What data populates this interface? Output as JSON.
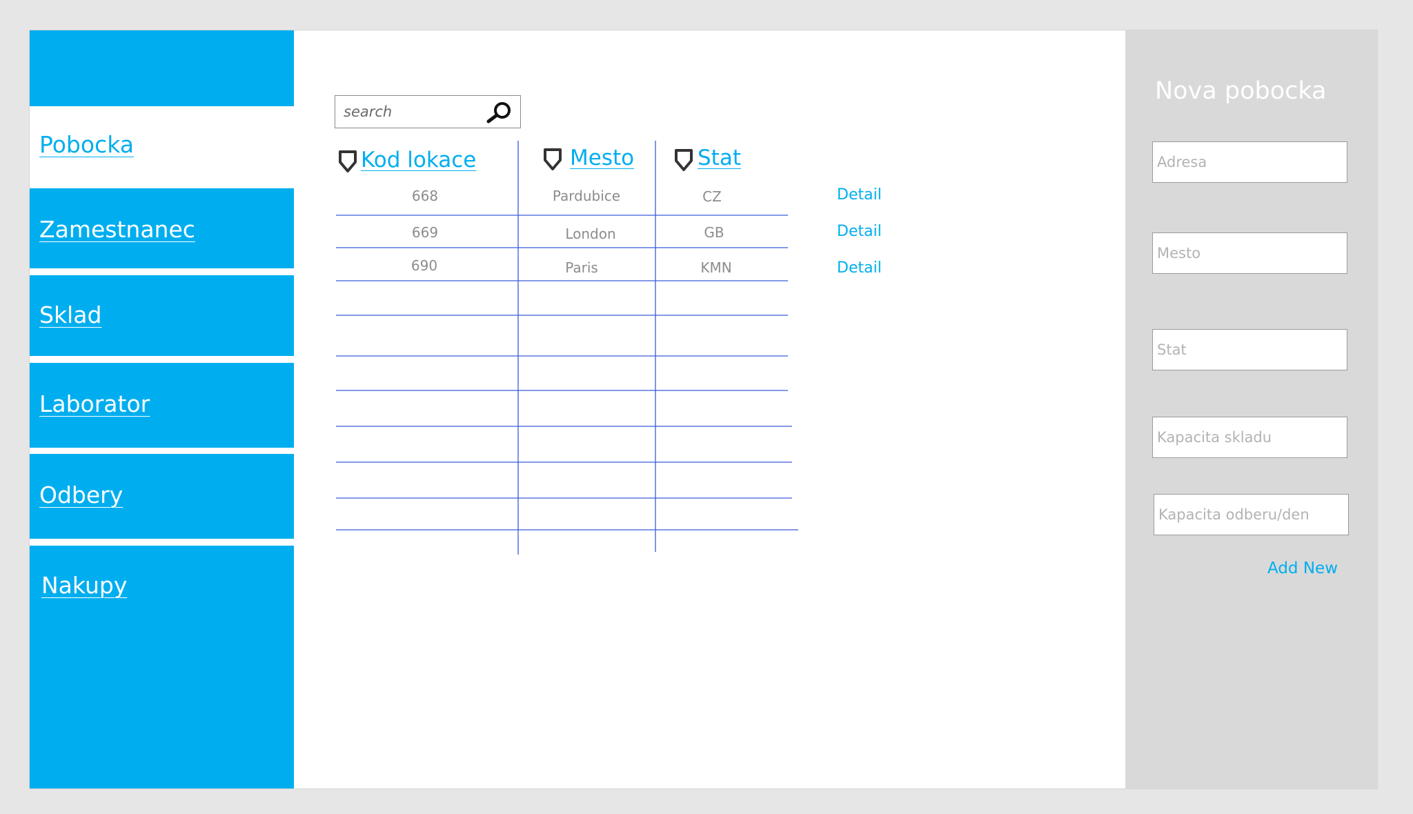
{
  "sidebar": {
    "items": [
      {
        "label": "Pobocka",
        "active": true
      },
      {
        "label": "Zamestnanec",
        "active": false
      },
      {
        "label": "Sklad",
        "active": false
      },
      {
        "label": "Laborator",
        "active": false
      },
      {
        "label": "Odbery",
        "active": false
      },
      {
        "label": "Nakupy",
        "active": false
      }
    ]
  },
  "main": {
    "search": {
      "placeholder": "search",
      "icon": "search-icon"
    },
    "table": {
      "columns": [
        {
          "label": "Kod lokace",
          "icon": "sort-shield-icon"
        },
        {
          "label": "Mesto",
          "icon": "sort-shield-icon"
        },
        {
          "label": "Stat",
          "icon": "sort-shield-icon"
        }
      ],
      "rows": [
        {
          "kod": "668",
          "mesto": "Pardubice",
          "stat": "CZ",
          "action": "Detail"
        },
        {
          "kod": "669",
          "mesto": "London",
          "stat": "GB",
          "action": "Detail"
        },
        {
          "kod": "690",
          "mesto": "Paris",
          "stat": "KMN",
          "action": "Detail"
        }
      ]
    }
  },
  "panel": {
    "title": "Nova pobocka",
    "fields": [
      {
        "placeholder": "Adresa"
      },
      {
        "placeholder": "Mesto"
      },
      {
        "placeholder": "Stat"
      },
      {
        "placeholder": "Kapacita skladu"
      },
      {
        "placeholder": "Kapacita odberu/den"
      }
    ],
    "add_label": "Add New"
  },
  "colors": {
    "accent": "#00aeef",
    "grid_line": "#3a5bd9",
    "panel_bg": "#d9d9d9",
    "page_bg": "#e6e6e6"
  }
}
